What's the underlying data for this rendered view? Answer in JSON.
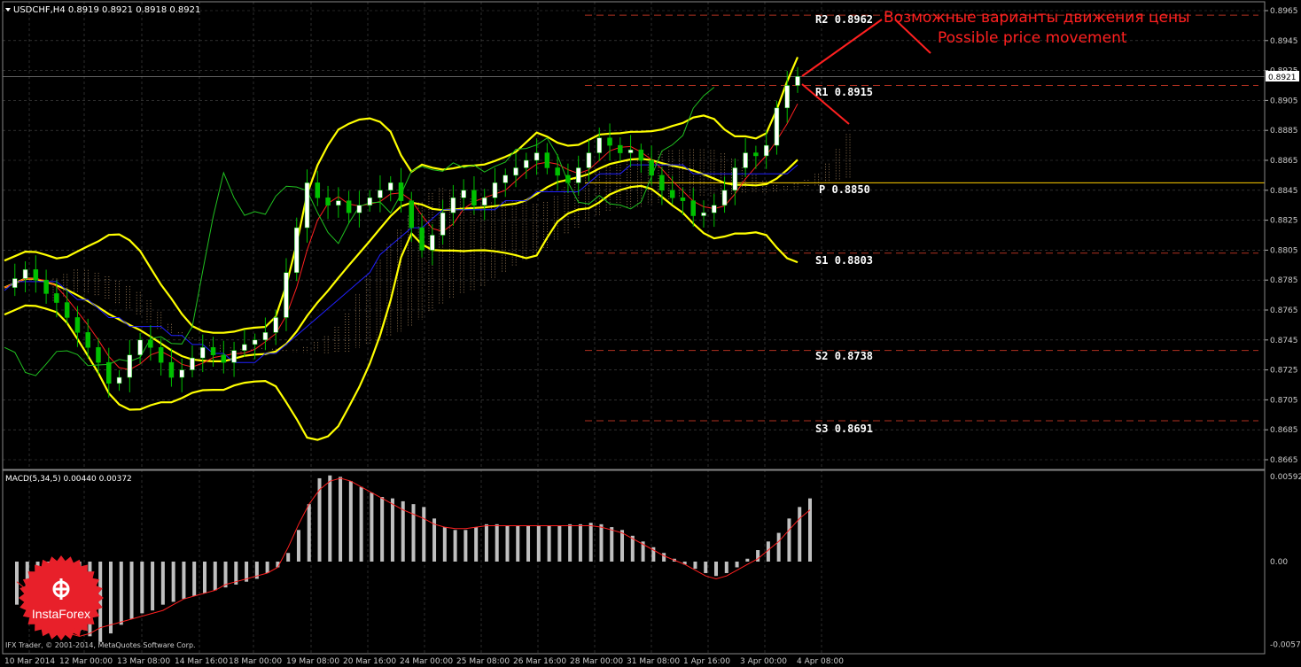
{
  "header": {
    "symbol_info": "USDCHF,H4  0.8919 0.8921 0.8918 0.8921",
    "current_price_tag": "0.8921"
  },
  "annotation": {
    "title_ru": "Возможные варианты движения цены",
    "title_en": "Possible price movement",
    "color": "#ff2020"
  },
  "pivot_levels": [
    {
      "label": "R2",
      "value": "0.8962",
      "price": 0.8962
    },
    {
      "label": "R1",
      "value": "0.8915",
      "price": 0.8915
    },
    {
      "label": "P",
      "value": "0.8850",
      "price": 0.885
    },
    {
      "label": "S1",
      "value": "0.8803",
      "price": 0.8803
    },
    {
      "label": "S2",
      "value": "0.8738",
      "price": 0.8738
    },
    {
      "label": "S3",
      "value": "0.8691",
      "price": 0.8691
    }
  ],
  "price_axis_ticks": [
    "0.8965",
    "0.8945",
    "0.8925",
    "0.8905",
    "0.8885",
    "0.8865",
    "0.8845",
    "0.8825",
    "0.8805",
    "0.8785",
    "0.8765",
    "0.8745",
    "0.8725",
    "0.8705",
    "0.8685",
    "0.8665"
  ],
  "time_axis_ticks": [
    "10 Mar 2014",
    "12 Mar 00:00",
    "13 Mar 08:00",
    "14 Mar 16:00",
    "18 Mar 00:00",
    "19 Mar 08:00",
    "20 Mar 16:00",
    "24 Mar 00:00",
    "25 Mar 08:00",
    "26 Mar 16:00",
    "28 Mar 00:00",
    "31 Mar 08:00",
    "1 Apr 16:00",
    "3 Apr 00:00",
    "4 Apr 08:00"
  ],
  "macd": {
    "label": "MACD(5,34,5) 0.00440 0.00372",
    "axis_ticks": [
      "0.00592",
      "0.00",
      "-0.00578"
    ]
  },
  "footer": {
    "copyright": "IFX Trader, © 2001-2014, MetaQuotes Software Corp."
  },
  "logo": {
    "text": "InstaForex",
    "color": "#e8202a"
  },
  "colors": {
    "background": "#000000",
    "grid": "#4a4a4a",
    "bollinger": "#ffff00",
    "ichimoku_cloud": "#c8a070",
    "tenkan": "#ff2020",
    "kijun": "#2020ff",
    "chikou": "#20c020",
    "pivot_lines": "#b03020",
    "pivot_p": "#ffcc00",
    "candle_up": "#ffffff",
    "candle_down": "#00c000",
    "macd_hist": "#c0c0c0",
    "macd_signal": "#ff2020"
  },
  "chart_data": {
    "type": "candlestick",
    "symbol": "USDCHF",
    "timeframe": "H4",
    "ylim": [
      0.866,
      0.8975
    ],
    "ohlc_path": [
      0.878,
      0.8786,
      0.8792,
      0.8785,
      0.8776,
      0.877,
      0.876,
      0.875,
      0.874,
      0.873,
      0.8716,
      0.872,
      0.8735,
      0.8745,
      0.874,
      0.873,
      0.872,
      0.8725,
      0.8733,
      0.874,
      0.8735,
      0.873,
      0.8738,
      0.8742,
      0.8745,
      0.875,
      0.876,
      0.879,
      0.882,
      0.885,
      0.884,
      0.8835,
      0.8838,
      0.883,
      0.8835,
      0.884,
      0.8845,
      0.885,
      0.8838,
      0.882,
      0.8805,
      0.8815,
      0.883,
      0.884,
      0.8845,
      0.8835,
      0.884,
      0.885,
      0.8855,
      0.886,
      0.8865,
      0.887,
      0.886,
      0.8855,
      0.885,
      0.886,
      0.887,
      0.888,
      0.8875,
      0.887,
      0.8872,
      0.8865,
      0.8855,
      0.8845,
      0.884,
      0.8838,
      0.8828,
      0.883,
      0.8835,
      0.8845,
      0.886,
      0.887,
      0.8868,
      0.8875,
      0.89,
      0.8915,
      0.8921
    ],
    "macd_histogram": [
      -0.003,
      -0.0032,
      -0.0034,
      -0.0036,
      -0.004,
      -0.0045,
      -0.0048,
      -0.0052,
      -0.0056,
      -0.005,
      -0.0044,
      -0.004,
      -0.0036,
      -0.0034,
      -0.003,
      -0.0028,
      -0.0026,
      -0.0024,
      -0.0022,
      -0.002,
      -0.0018,
      -0.0016,
      -0.0014,
      -0.0012,
      -0.0008,
      -0.0004,
      0.0006,
      0.0022,
      0.004,
      0.0058,
      0.006,
      0.0059,
      0.0056,
      0.0052,
      0.0048,
      0.0045,
      0.0044,
      0.0042,
      0.004,
      0.0038,
      0.003,
      0.0024,
      0.0022,
      0.0022,
      0.0024,
      0.0026,
      0.0026,
      0.0025,
      0.0025,
      0.0025,
      0.0025,
      0.0025,
      0.0025,
      0.0026,
      0.0026,
      0.0027,
      0.0026,
      0.0024,
      0.0022,
      0.0018,
      0.0014,
      0.001,
      0.0006,
      0.0002,
      -0.0002,
      -0.0005,
      -0.0008,
      -0.001,
      -0.0008,
      -0.0004,
      0.0002,
      0.0008,
      0.0014,
      0.002,
      0.003,
      0.0038,
      0.0044
    ],
    "macd_signal": [
      -0.0014,
      -0.002,
      -0.0028,
      -0.0038,
      -0.0046,
      -0.005,
      -0.0052,
      -0.005,
      -0.0046,
      -0.0044,
      -0.0042,
      -0.004,
      -0.0038,
      -0.0036,
      -0.0034,
      -0.003,
      -0.0026,
      -0.0024,
      -0.0022,
      -0.002,
      -0.0016,
      -0.0014,
      -0.0012,
      -0.001,
      -0.0008,
      -0.0004,
      0.001,
      0.0026,
      0.004,
      0.005,
      0.0056,
      0.0058,
      0.0056,
      0.0052,
      0.0048,
      0.0044,
      0.004,
      0.0036,
      0.0033,
      0.003,
      0.0026,
      0.0024,
      0.0023,
      0.0023,
      0.0024,
      0.0025,
      0.0025,
      0.0025,
      0.0025,
      0.0025,
      0.0025,
      0.0025,
      0.0025,
      0.0025,
      0.0025,
      0.0025,
      0.0024,
      0.0022,
      0.002,
      0.0016,
      0.0012,
      0.0008,
      0.0004,
      0.0001,
      -0.0002,
      -0.0006,
      -0.001,
      -0.0012,
      -0.001,
      -0.0006,
      -0.0002,
      0.0002,
      0.0008,
      0.0014,
      0.0022,
      0.003,
      0.0036
    ]
  }
}
